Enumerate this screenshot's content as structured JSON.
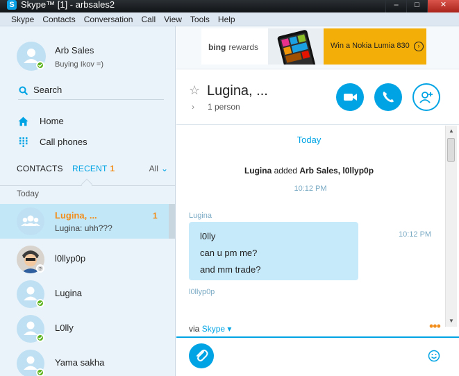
{
  "window": {
    "title": "Skype™ [1] - arbsales2",
    "minimize": "–",
    "maximize": "□",
    "close": "✕"
  },
  "menu": [
    "Skype",
    "Contacts",
    "Conversation",
    "Call",
    "View",
    "Tools",
    "Help"
  ],
  "profile": {
    "name": "Arb Sales",
    "mood": "Buying Ikov =)",
    "status": "online"
  },
  "nav": {
    "search": "Search",
    "home": "Home",
    "call_phones": "Call phones"
  },
  "tabs": {
    "contacts": "CONTACTS",
    "recent": "RECENT",
    "recent_count": "1",
    "filter": "All"
  },
  "list_group": "Today",
  "contacts": [
    {
      "name": "Lugina, ...",
      "preview": "Lugina: uhh???",
      "unread": "1",
      "selected": true,
      "status": "group"
    },
    {
      "name": "l0llyp0p",
      "preview": "",
      "status": "unknown"
    },
    {
      "name": "Lugina",
      "preview": "",
      "status": "online"
    },
    {
      "name": "L0lly",
      "preview": "",
      "status": "online"
    },
    {
      "name": "Yama sakha",
      "preview": "",
      "status": "online"
    }
  ],
  "ad": {
    "brand": "bing",
    "brand_suffix": "rewards",
    "text": "Win a Nokia Lumia 830",
    "arrow": "›"
  },
  "conversation": {
    "title": "Lugina, ...",
    "subtitle": "1 person"
  },
  "chat": {
    "day": "Today",
    "system": {
      "actor": "Lugina",
      "verb": "added",
      "targets": "Arb Sales, l0llyp0p",
      "time": "10:12 PM"
    },
    "messages": [
      {
        "sender": "Lugina",
        "lines": [
          "l0lly",
          "can u pm me?",
          "and mm trade?"
        ],
        "time": "10:12 PM"
      }
    ],
    "next_sender": "l0llyp0p"
  },
  "composer": {
    "via_prefix": "via",
    "via_service": "Skype",
    "more": "•••"
  },
  "colors": {
    "accent": "#00a4e4",
    "orange": "#f28e1b",
    "online": "#5bb31b",
    "sidebar_bg": "#eaf3fa"
  }
}
